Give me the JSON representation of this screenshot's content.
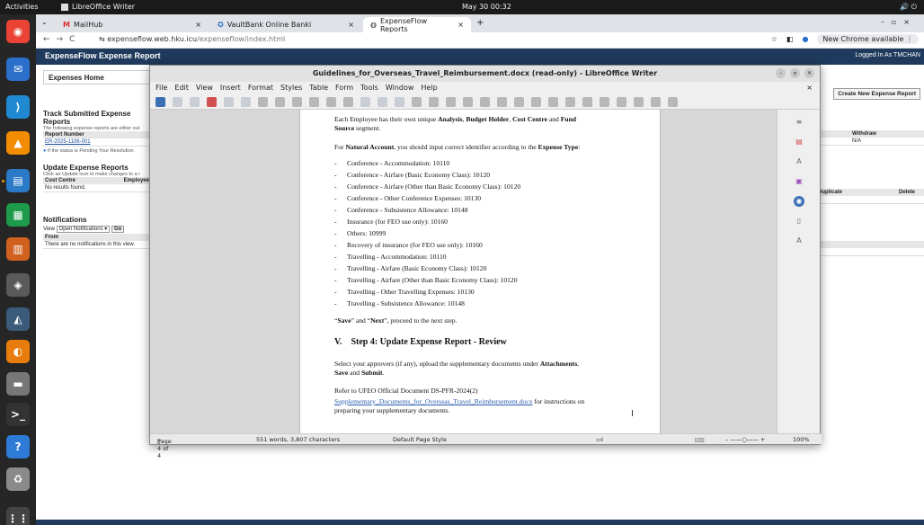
{
  "topbar": {
    "activities": "Activities",
    "app_name": "LibreOffice Writer",
    "clock": "May 30 00:32"
  },
  "dock": {
    "items": [
      {
        "name": "chrome-icon",
        "color": "#ea4335"
      },
      {
        "name": "thunderbird-icon",
        "color": "#2a6fc9"
      },
      {
        "name": "vscode-icon",
        "color": "#1f8ad2"
      },
      {
        "name": "vlc-icon",
        "color": "#f28c00"
      },
      {
        "name": "writer-icon",
        "color": "#2a7ac7"
      },
      {
        "name": "calc-icon",
        "color": "#1e9a4b"
      },
      {
        "name": "impress-icon",
        "color": "#d0611e"
      },
      {
        "name": "gimp-icon",
        "color": "#5a5a5a"
      },
      {
        "name": "image-viewer-icon",
        "color": "#3b5b7a"
      },
      {
        "name": "blender-icon",
        "color": "#e87d0d"
      },
      {
        "name": "files-icon",
        "color": "#777777"
      },
      {
        "name": "terminal-icon",
        "color": "#333333"
      },
      {
        "name": "help-icon",
        "color": "#2d7bd6"
      },
      {
        "name": "trash-icon",
        "color": "#8a8a8a"
      },
      {
        "name": "app-grid-icon",
        "color": "#444444"
      }
    ]
  },
  "browser": {
    "tabs": [
      {
        "label": "MailHub",
        "active": false
      },
      {
        "label": "VaultBank Online Banki",
        "active": false
      },
      {
        "label": "ExpenseFlow Reports",
        "active": true
      }
    ],
    "url_host": "expenseflow.web.hku.icu",
    "url_path": "/expenseflow/index.html",
    "new_chrome": "New Chrome available"
  },
  "expenseflow": {
    "brand": "ExpenseFlow Expense Report",
    "logged_in": "Logged In As TMCHAN",
    "home_title": "Expenses Home",
    "create_button": "Create New Expense Report",
    "track": {
      "heading": "Track Submitted Expense Reports",
      "subtext": "The following expense reports are either out",
      "col_report": "Report Number",
      "report_link": "ER-2025-1106-001",
      "col_withdraw": "Withdraw",
      "withdraw_value": "N/A",
      "note": "If the status is Pending Your Resolution"
    },
    "update": {
      "heading": "Update Expense Reports",
      "subtext": "Click an Update icon to make changes to a r",
      "col_cost": "Cost Centre",
      "col_employee": "Employee",
      "col_duplicate": "Duplicate",
      "col_delete": "Delete",
      "empty": "No results found."
    },
    "notifications": {
      "heading": "Notifications",
      "view_label": "View",
      "view_option": "Open Notifications",
      "go": "Go",
      "col_from": "From",
      "empty": "There are no notifications in this view."
    }
  },
  "writer": {
    "title": "Guidelines_for_Overseas_Travel_Reimbursement.docx (read-only) - LibreOffice Writer",
    "menu": [
      "File",
      "Edit",
      "View",
      "Insert",
      "Format",
      "Styles",
      "Table",
      "Form",
      "Tools",
      "Window",
      "Help"
    ],
    "doc": {
      "p1_a": "Each Employee has their own unique ",
      "p1_b1": "Analysis",
      "p1_c": ", ",
      "p1_b2": "Budget Holder",
      "p1_d": ", ",
      "p1_b3": "Cost Centre",
      "p1_e": " and ",
      "p1_b4": "Fund",
      "p1_f": "Source",
      "p1_g": " segment.",
      "p2_a": "For ",
      "p2_b": "Natural Account",
      "p2_c": ", you should input correct identifier according to the ",
      "p2_d": "Expense Type",
      "p2_e": ":",
      "bullets": [
        "Conference - Accommodation: 10110",
        "Conference - Airfare (Basic Economy Class): 10120",
        "Conference - Airfare (Other than Basic Economy Class): 10120",
        "Conference - Other Conference Expenses: 10130",
        "Conference - Subsistence Allowance: 10148",
        "Insurance (for FEO use only): 10160",
        "Others: 10999",
        "Recovery of insurance (for FEO use only): 10160",
        "Travelling - Accommodation: 10110",
        "Travelling - Airfare (Basic Economy Class): 10120",
        "Travelling - Airfare (Other than Basic Economy Class): 10120",
        "Travelling - Other Travelling Expenses: 10130",
        "Travelling - Subsistence Allowance: 10148"
      ],
      "save_next_a": "“",
      "save_next_b1": "Save",
      "save_next_c": "” and “",
      "save_next_b2": "Next",
      "save_next_d": "”, proceed to the next step.",
      "heading_num": "V.",
      "heading_text": "Step 4: Update Expense Report - Review",
      "p3_a": "Select your approvers (if any), upload the supplementary documents under ",
      "p3_b": "Attachments",
      "p3_c": ",",
      "p3_d": "Save",
      "p3_e": " and ",
      "p3_f": "Submit",
      "p3_g": ".",
      "p4": "Refer to UFEO Official Document DS-PFR-2024(2)",
      "p5_link": "Supplementary_Documents_for_Overseas_Travel_Reimbursement.docx",
      "p5_rest": " for instructions on",
      "p6": "preparing your supplementary documents."
    },
    "status": {
      "page": "Page 4 of 4",
      "words": "551 words, 3,807 characters",
      "style": "Default Page Style",
      "zoom": "100%"
    }
  }
}
